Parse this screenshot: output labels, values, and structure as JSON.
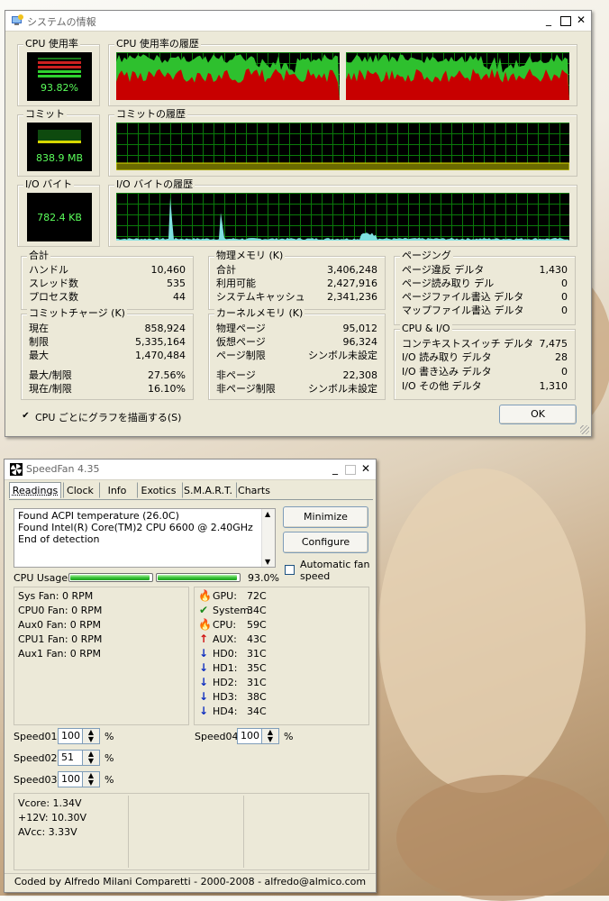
{
  "sysinfo": {
    "title": "システムの情報",
    "cpu_usage": {
      "label": "CPU 使用率",
      "value": "93.82%",
      "level": 0.9382
    },
    "cpu_history_label": "CPU 使用率の履歴",
    "commit": {
      "label": "コミット",
      "value": "838.9 MB"
    },
    "commit_history_label": "コミットの履歴",
    "io": {
      "label": "I/O バイト",
      "value": "782.4  KB"
    },
    "io_history_label": "I/O バイトの履歴",
    "totals": {
      "title": "合計",
      "rows": [
        {
          "k": "ハンドル",
          "v": "10,460"
        },
        {
          "k": "スレッド数",
          "v": "535"
        },
        {
          "k": "プロセス数",
          "v": "44"
        }
      ]
    },
    "commit_charge": {
      "title": "コミットチャージ (K)",
      "rows": [
        {
          "k": "現在",
          "v": "858,924"
        },
        {
          "k": "制限",
          "v": "5,335,164"
        },
        {
          "k": "最大",
          "v": "1,470,484"
        },
        {
          "k": "最大/制限",
          "v": "27.56%"
        },
        {
          "k": "現在/制限",
          "v": "16.10%"
        }
      ]
    },
    "physical_memory": {
      "title": "物理メモリ (K)",
      "rows": [
        {
          "k": "合計",
          "v": "3,406,248"
        },
        {
          "k": "利用可能",
          "v": "2,427,916"
        },
        {
          "k": "システムキャッシュ",
          "v": "2,341,236"
        }
      ]
    },
    "kernel_memory": {
      "title": "カーネルメモリ (K)",
      "rows": [
        {
          "k": "物理ページ",
          "v": "95,012"
        },
        {
          "k": "仮想ページ",
          "v": "96,324"
        },
        {
          "k": "ページ制限",
          "v": "シンボル未設定"
        },
        {
          "k": "非ページ",
          "v": "22,308"
        },
        {
          "k": "非ページ制限",
          "v": "シンボル未設定"
        }
      ]
    },
    "paging": {
      "title": "ページング",
      "rows": [
        {
          "k": "ページ違反 デルタ",
          "v": "1,430"
        },
        {
          "k": "ページ読み取り デル",
          "v": "0"
        },
        {
          "k": "ページファイル書込 デルタ",
          "v": "0"
        },
        {
          "k": "マップファイル書込 デルタ",
          "v": "0"
        }
      ]
    },
    "cpu_io": {
      "title": "CPU & I/O",
      "rows": [
        {
          "k": "コンテキストスイッチ デルタ",
          "v": "7,475"
        },
        {
          "k": "I/O 読み取り デルタ",
          "v": "28"
        },
        {
          "k": "I/O 書き込み デルタ",
          "v": "0"
        },
        {
          "k": "I/O その他 デルタ",
          "v": "1,310"
        }
      ]
    },
    "per_cpu_checkbox": "CPU ごとにグラフを描画する(S)",
    "ok_label": "OK"
  },
  "speedfan": {
    "title": "SpeedFan 4.35",
    "tabs": [
      "Readings",
      "Clock",
      "Info",
      "Exotics",
      "S.M.A.R.T.",
      "Charts"
    ],
    "log_lines": [
      "Found ACPI temperature (26.0C)",
      "Found Intel(R) Core(TM)2 CPU 6600 @ 2.40GHz",
      "End of detection"
    ],
    "minimize_label": "Minimize",
    "configure_label": "Configure",
    "auto_fan_label_1": "Automatic fan",
    "auto_fan_label_2": "speed",
    "cpu_usage_label": "CPU Usage",
    "cpu_usage_value": "93.0%",
    "cpu_bars": [
      0.96,
      0.96
    ],
    "fans": [
      "Sys Fan:   0 RPM",
      "CPU0 Fan: 0 RPM",
      "Aux0 Fan: 0 RPM",
      "CPU1 Fan: 0 RPM",
      "Aux1 Fan: 0 RPM"
    ],
    "temps": [
      {
        "icon": "flame",
        "name": "GPU:",
        "value": "72C"
      },
      {
        "icon": "check",
        "name": "System:",
        "value": "34C"
      },
      {
        "icon": "flame",
        "name": "CPU:",
        "value": "59C"
      },
      {
        "icon": "up-arrow",
        "name": "AUX:",
        "value": "43C"
      },
      {
        "icon": "down-arrow",
        "name": "HD0:",
        "value": "31C"
      },
      {
        "icon": "down-arrow",
        "name": "HD1:",
        "value": "35C"
      },
      {
        "icon": "down-arrow",
        "name": "HD2:",
        "value": "31C"
      },
      {
        "icon": "down-arrow",
        "name": "HD3:",
        "value": "38C"
      },
      {
        "icon": "down-arrow",
        "name": "HD4:",
        "value": "34C"
      }
    ],
    "speeds": [
      {
        "label": "Speed01:",
        "value": "100",
        "unit": "%"
      },
      {
        "label": "Speed02:",
        "value": "51",
        "unit": "%"
      },
      {
        "label": "Speed03:",
        "value": "100",
        "unit": "%"
      },
      {
        "label": "Speed04:",
        "value": "100",
        "unit": "%"
      }
    ],
    "voltages": [
      "Vcore:   1.34V",
      "+12V:   10.30V",
      "AVcc:    3.33V"
    ],
    "footer": "Coded by Alfredo Milani Comparetti - 2000-2008 - alfredo@almico.com"
  },
  "colors": {
    "graph_green": "#2ec02e",
    "graph_red": "#c80000",
    "graph_yellow": "#dede00",
    "io_cyan": "#7fe0e0"
  }
}
